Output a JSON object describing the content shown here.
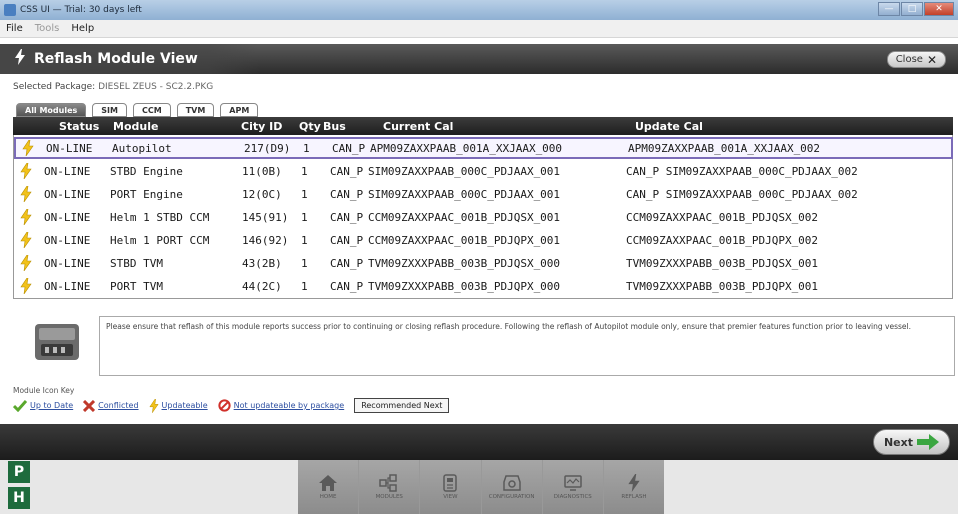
{
  "window": {
    "title": "CSS UI — Trial: 30 days left",
    "controls": [
      "—",
      "□",
      "✕"
    ]
  },
  "menu": [
    {
      "label": "File",
      "enabled": true
    },
    {
      "label": "Tools",
      "enabled": false
    },
    {
      "label": "Help",
      "enabled": true
    }
  ],
  "header": {
    "title": "Reflash Module View",
    "close_label": "Close"
  },
  "package": {
    "label": "Selected Package:",
    "value": "DIESEL ZEUS - SC2.2.PKG"
  },
  "tabs": [
    {
      "label": "All Modules",
      "active": true
    },
    {
      "label": "SIM",
      "active": false
    },
    {
      "label": "CCM",
      "active": false
    },
    {
      "label": "TVM",
      "active": false
    },
    {
      "label": "APM",
      "active": false
    }
  ],
  "table": {
    "columns": [
      "Status",
      "Module",
      "City ID",
      "Qty",
      "Bus",
      "Current Cal",
      "Update Cal"
    ],
    "rows": [
      {
        "status": "ON-LINE",
        "module": "Autopilot",
        "city_id": "217(D9)",
        "qty": "1",
        "bus": "CAN_P",
        "current": "APM09ZAXXPAAB_001A_XXJAAX_000",
        "update": "APM09ZAXXPAAB_001A_XXJAAX_002",
        "selected": true
      },
      {
        "status": "ON-LINE",
        "module": "STBD Engine",
        "city_id": "11(0B)",
        "qty": "1",
        "bus": "CAN_P",
        "current": "SIM09ZAXXPAAB_000C_PDJAAX_001",
        "update": "CAN_P SIM09ZAXXPAAB_000C_PDJAAX_002",
        "selected": false
      },
      {
        "status": "ON-LINE",
        "module": "PORT Engine",
        "city_id": "12(0C)",
        "qty": "1",
        "bus": "CAN_P",
        "current": "SIM09ZAXXPAAB_000C_PDJAAX_001",
        "update": "CAN_P SIM09ZAXXPAAB_000C_PDJAAX_002",
        "selected": false
      },
      {
        "status": "ON-LINE",
        "module": "Helm 1 STBD CCM",
        "city_id": "145(91)",
        "qty": "1",
        "bus": "CAN_P",
        "current": "CCM09ZAXXPAAC_001B_PDJQSX_001",
        "update": "CCM09ZAXXPAAC_001B_PDJQSX_002",
        "selected": false
      },
      {
        "status": "ON-LINE",
        "module": "Helm 1 PORT CCM",
        "city_id": "146(92)",
        "qty": "1",
        "bus": "CAN_P",
        "current": "CCM09ZAXXPAAC_001B_PDJQPX_001",
        "update": "CCM09ZAXXPAAC_001B_PDJQPX_002",
        "selected": false
      },
      {
        "status": "ON-LINE",
        "module": "STBD TVM",
        "city_id": "43(2B)",
        "qty": "1",
        "bus": "CAN_P",
        "current": "TVM09ZXXXPABB_003B_PDJQSX_000",
        "update": "TVM09ZXXXPABB_003B_PDJQSX_001",
        "selected": false
      },
      {
        "status": "ON-LINE",
        "module": "PORT TVM",
        "city_id": "44(2C)",
        "qty": "1",
        "bus": "CAN_P",
        "current": "TVM09ZXXXPABB_003B_PDJQPX_000",
        "update": "TVM09ZXXXPABB_003B_PDJQPX_001",
        "selected": false
      }
    ]
  },
  "notice": "Please ensure that reflash of this module reports success prior to continuing or closing reflash procedure. Following the reflash of Autopilot module only, ensure that premier features function prior to leaving vessel.",
  "key": {
    "title": "Module Icon Key",
    "items": [
      {
        "label": "Up to Date",
        "icon": "check-icon",
        "color": "#5aa82c"
      },
      {
        "label": "Conflicted",
        "icon": "x-icon",
        "color": "#c0392b"
      },
      {
        "label": "Updateable",
        "icon": "bolt-icon",
        "color": "#f2c21b"
      },
      {
        "label": "Not updateable by package",
        "icon": "no-icon",
        "color": "#d0302a"
      }
    ],
    "recommended": "Recommended Next"
  },
  "next_label": "Next",
  "side_badges": [
    "P",
    "H"
  ],
  "nav": [
    {
      "label": "HOME",
      "icon": "home-icon"
    },
    {
      "label": "MODULES",
      "icon": "modules-icon"
    },
    {
      "label": "VIEW",
      "icon": "view-icon"
    },
    {
      "label": "CONFIGURATION",
      "icon": "config-icon"
    },
    {
      "label": "DIAGNOSTICS",
      "icon": "diagnostics-icon"
    },
    {
      "label": "REFLASH",
      "icon": "bolt-icon"
    }
  ],
  "colors": {
    "bolt": "#f2c21b",
    "selection": "#7b6bb8",
    "header_dark": "#2c2c2c",
    "ph_green": "#1e6b3d"
  }
}
